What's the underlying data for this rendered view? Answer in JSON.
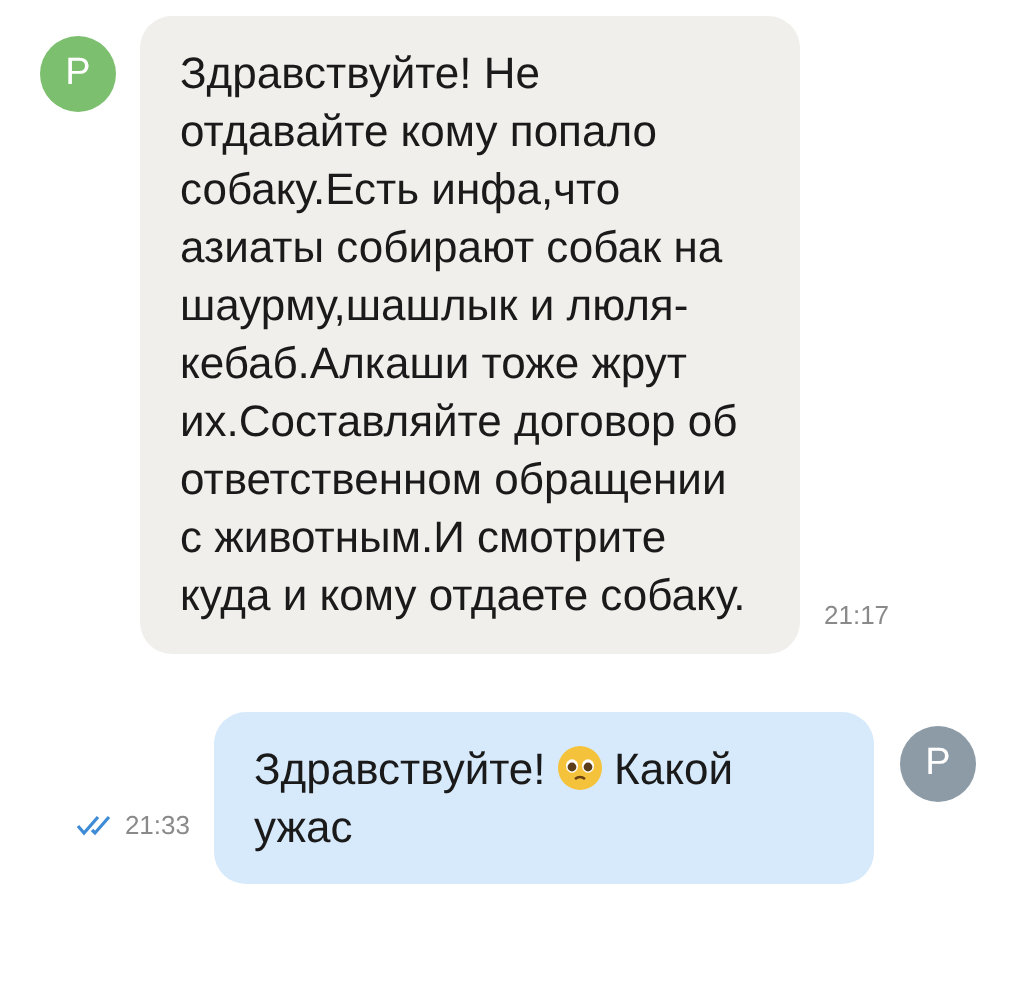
{
  "messages": [
    {
      "kind": "incoming",
      "avatar": "P",
      "color": "#7cbf6e",
      "parts": [
        {
          "kind": "text",
          "text": "Здравствуйте! Не отдавайте кому попало собаку.Есть инфа,что азиаты собирают собак на шаурму,шашлык и люля-кебаб.Алкаши тоже жрут их.Составляйте договор об ответственном обращении с животным.И смотрите куда и кому отдаете собаку."
        }
      ],
      "time": "21:17"
    },
    {
      "kind": "outgoing",
      "avatar": "P",
      "color": "#8d9ba6",
      "parts": [
        {
          "kind": "text",
          "text": "Здравствуйте!"
        },
        {
          "kind": "emoji"
        },
        {
          "kind": "text",
          "text": "Какой ужас"
        }
      ],
      "time": "21:33",
      "read": true
    }
  ]
}
